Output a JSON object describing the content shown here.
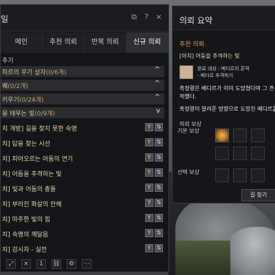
{
  "quest_window": {
    "title": "일",
    "controls": {
      "popout_icon": "⧉",
      "help_icon": "?",
      "close_icon": "×"
    },
    "tabs": [
      {
        "label": "메인"
      },
      {
        "label": "추천 의뢰"
      },
      {
        "label": "반복 의뢰"
      },
      {
        "label": "신규 의뢰",
        "active": true
      }
    ],
    "search_text": "추기",
    "categories": [
      {
        "label": "피르의 무기 상자",
        "count": "(0/6개)"
      },
      {
        "label": "퀘",
        "count": "(0/2개)"
      },
      {
        "label": "키우기",
        "count": "(0/24개)"
      },
      {
        "label": "을 태우는 빛",
        "count": "(0/9개)"
      }
    ],
    "quests": [
      "치 개방] 길을 찾지 못한 숙명",
      "치] 답을 찾는 시선",
      "치] 피어오르는 어둠의 연기",
      "치] 어둠을 추격하는 빛",
      "치] 빛과 어둠의 충돌",
      "치] 부러진 화살의 잔해",
      "치] 마주한 빛의 힘",
      "치] 숙명의 깨달음",
      "치] 감시자 - 실전"
    ]
  },
  "summary_window": {
    "title": "의뢰 요약",
    "recommend_label": "추천 의뢰",
    "quest_name": "[아치] 어둠을 추격하는 빛",
    "target_title": "완료 대상 : 베디르의 흔적",
    "target_sub": "- 베디르 추격하기",
    "desc_line1": "흑정령은 베디르가 이미 도망쳤다며 그 흔",
    "desc_line2": "적했다.",
    "desc_line3": "흑정령이 알려준 방향으로 도망친 베디르를",
    "reward_title": "의뢰 보상",
    "basic_reward_label": "기본 보상",
    "select_reward_label": "선택 보상",
    "find_button": "길 찾기"
  },
  "colors": {
    "accent_gold": "#d4a54c",
    "panel_bg": "#151619"
  }
}
